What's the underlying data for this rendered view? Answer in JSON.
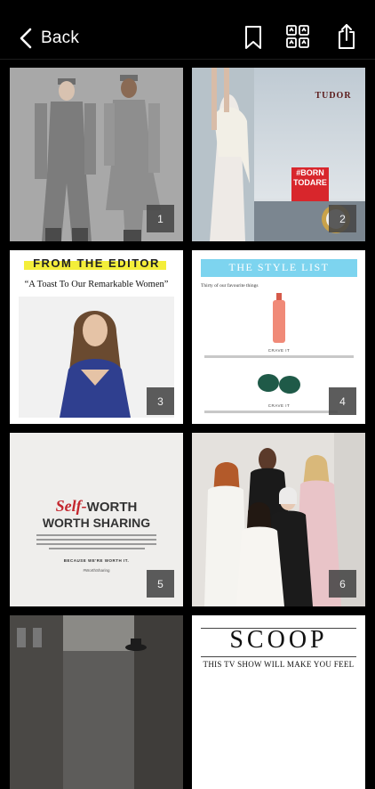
{
  "header": {
    "back_label": "Back",
    "icons": [
      "chevron-left-icon",
      "bookmark-icon",
      "grid-icon",
      "share-icon"
    ]
  },
  "pages": [
    {
      "number": "1"
    },
    {
      "number": "2",
      "brand": "TUDOR",
      "badge_line1": "#BORN",
      "badge_line2": "TODARE"
    },
    {
      "number": "3",
      "heading": "FROM THE EDITOR",
      "subtitle": "“A Toast To Our Remarkable Women”"
    },
    {
      "number": "4",
      "heading": "THE STYLE LIST",
      "intro": "Thirty of our favourite things",
      "caption1": "CRAVE IT",
      "caption2": "CRAVE IT"
    },
    {
      "number": "5",
      "title_part1": "Self-",
      "title_part2": "WORTH",
      "title_line2": "WORTH SHARING",
      "tagline": "BECAUSE WE'RE WORTH IT.",
      "hashtag": "#WorthSharing"
    },
    {
      "number": "6"
    },
    {},
    {
      "heading": "SCOOP",
      "subtitle": "THIS TV SHOW WILL MAKE YOU FEEL"
    }
  ],
  "colors": {
    "background": "#000000",
    "editor_highlight": "#f4ee3a",
    "style_list_band": "#7dd4ef",
    "badge_red": "#d8262c",
    "self_red": "#c3262d"
  }
}
